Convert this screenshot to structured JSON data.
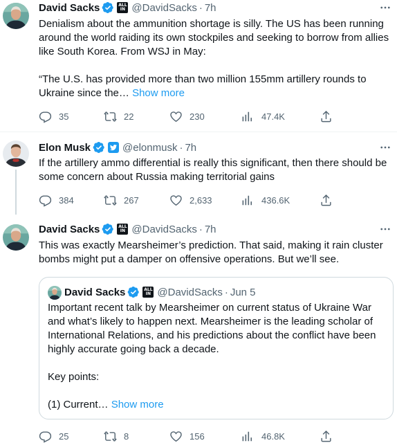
{
  "tweets": [
    {
      "name": "David Sacks",
      "handle": "@DavidSacks",
      "dot": "·",
      "time": "7h",
      "text": "Denialism about the ammunition shortage is silly. The US has been running around the world raiding its own stockpiles and seeking to borrow from allies like South Korea. From WSJ in May:\n\n“The U.S. has provided more than two million 155mm artillery rounds to Ukraine since the…",
      "show_more": "Show more",
      "replies": "35",
      "retweets": "22",
      "likes": "230",
      "views": "47.4K"
    },
    {
      "name": "Elon Musk",
      "handle": "@elonmusk",
      "dot": "·",
      "time": "7h",
      "text": "If the artillery ammo differential is really this significant, then there should be some concern about Russia making territorial gains",
      "replies": "384",
      "retweets": "267",
      "likes": "2,633",
      "views": "436.6K"
    },
    {
      "name": "David Sacks",
      "handle": "@DavidSacks",
      "dot": "·",
      "time": "7h",
      "text": "This was exactly Mearsheimer’s prediction. That said, making it rain cluster bombs might put a damper on offensive operations. But we’ll see.",
      "replies": "25",
      "retweets": "8",
      "likes": "156",
      "views": "46.8K",
      "quote": {
        "name": "David Sacks",
        "handle": "@DavidSacks",
        "dot": "·",
        "time": "Jun 5",
        "text": "Important recent talk by Mearsheimer on current status of Ukraine War and what’s likely to happen next. Mearsheimer is the leading scholar of International Relations, and his predictions about the conflict have been highly accurate going back a decade.\n\nKey points:\n\n(1) Current…",
        "show_more": "Show more"
      }
    }
  ],
  "colors": {
    "accent": "#1d9bf0",
    "muted": "#536471",
    "border": "#cfd9de"
  }
}
